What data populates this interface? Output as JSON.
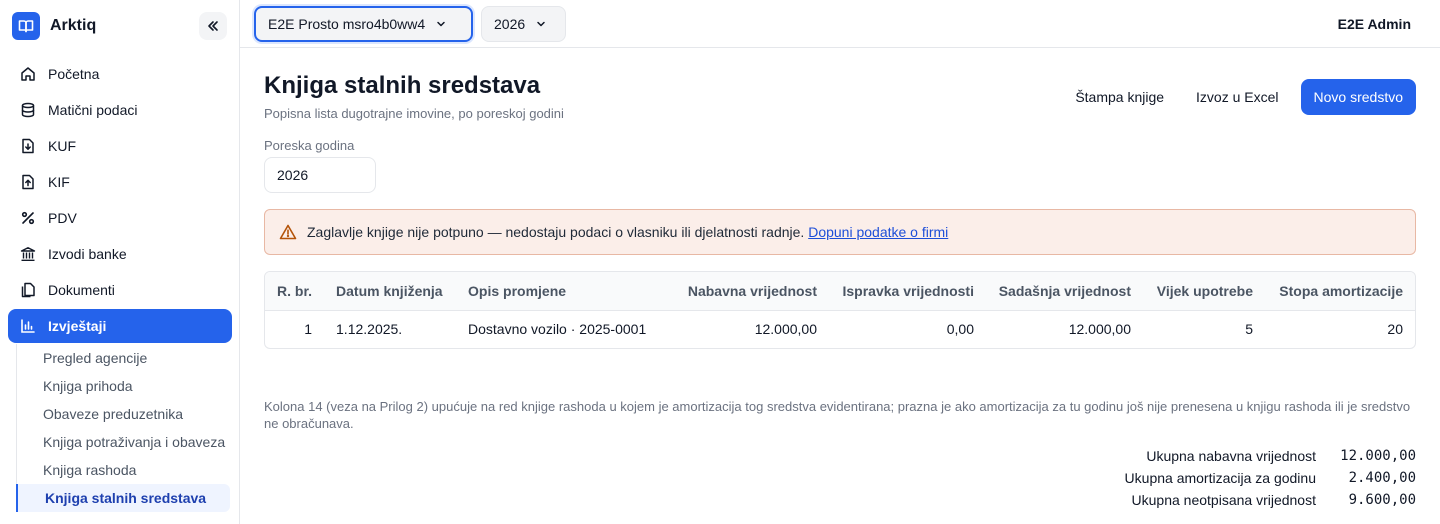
{
  "app": {
    "name": "Arktiq"
  },
  "sidebar": {
    "items": [
      {
        "label": "Početna",
        "icon": "home-icon"
      },
      {
        "label": "Matični podaci",
        "icon": "database-icon"
      },
      {
        "label": "KUF",
        "icon": "file-download-icon"
      },
      {
        "label": "KIF",
        "icon": "file-upload-icon"
      },
      {
        "label": "PDV",
        "icon": "percent-icon"
      },
      {
        "label": "Izvodi banke",
        "icon": "bank-icon"
      },
      {
        "label": "Dokumenti",
        "icon": "documents-icon"
      },
      {
        "label": "Izvještaji",
        "icon": "bar-chart-icon",
        "active": true
      }
    ],
    "sub_items": [
      {
        "label": "Pregled agencije"
      },
      {
        "label": "Knjiga prihoda"
      },
      {
        "label": "Obaveze preduzetnika"
      },
      {
        "label": "Knjiga potraživanja i obaveza"
      },
      {
        "label": "Knjiga rashoda"
      },
      {
        "label": "Knjiga stalnih sredstava",
        "active": true
      }
    ]
  },
  "topbar": {
    "org_select": "E2E Prosto msro4b0ww4",
    "year_select": "2026",
    "user": "E2E Admin"
  },
  "page": {
    "title": "Knjiga stalnih sredstava",
    "subtitle": "Popisna lista dugotrajne imovine, po poreskoj godini",
    "print_label": "Štampa knjige",
    "export_label": "Izvoz u Excel",
    "new_label": "Novo sredstvo",
    "year_label": "Poreska godina",
    "year_value": "2026"
  },
  "alert": {
    "text": "Zaglavlje knjige nije potpuno — nedostaju podaci o vlasniku ili djelatnosti radnje.",
    "link": "Dopuni podatke o firmi"
  },
  "table": {
    "headers": [
      "R. br.",
      "Datum knjiženja",
      "Opis promjene",
      "Nabavna vrijednost",
      "Ispravka vrijednosti",
      "Sadašnja vrijednost",
      "Vijek upotrebe",
      "Stopa amortizacije"
    ],
    "rows": [
      [
        "1",
        "1.12.2025.",
        "Dostavno vozilo · 2025-0001",
        "12.000,00",
        "0,00",
        "12.000,00",
        "5",
        "20"
      ]
    ]
  },
  "note": "Kolona 14 (veza na Prilog 2) upućuje na red knjige rashoda u kojem je amortizacija tog sredstva evidentirana; prazna je ako amortizacija za tu godinu još nije prenesena u knjigu rashoda ili je sredstvo ne obračunava.",
  "totals": [
    {
      "label": "Ukupna nabavna vrijednost",
      "value": "12.000,00"
    },
    {
      "label": "Ukupna amortizacija za godinu",
      "value": "2.400,00"
    },
    {
      "label": "Ukupna neotpisana vrijednost",
      "value": "9.600,00"
    }
  ],
  "colors": {
    "accent": "#2563eb",
    "alert_bg": "#fbeee9",
    "alert_border": "#e8b8a4"
  }
}
